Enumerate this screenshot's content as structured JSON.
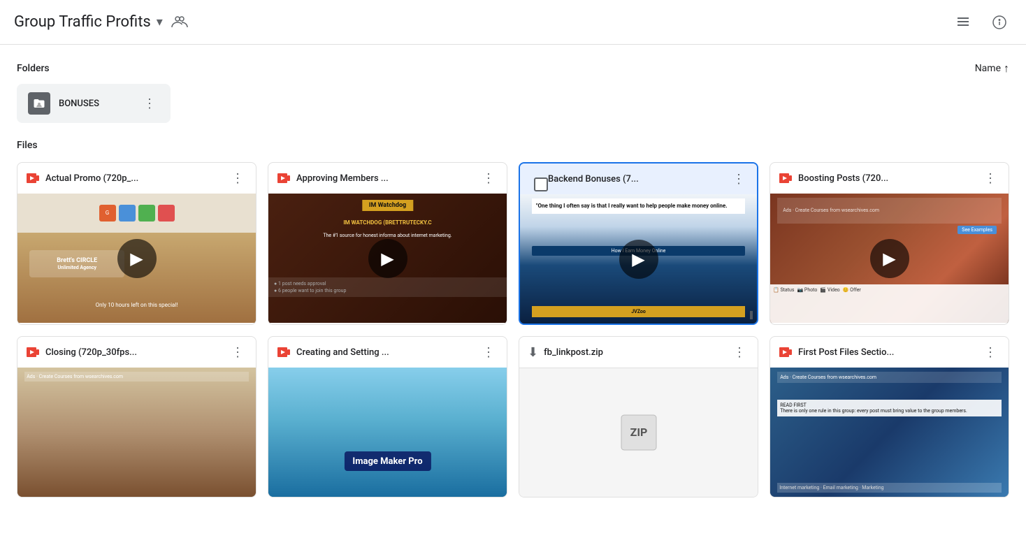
{
  "header": {
    "title": "Group Traffic Profits",
    "dropdown_label": "▾",
    "people_icon": "people-icon",
    "list_view_icon": "list-view-icon",
    "info_icon": "info-icon"
  },
  "sections": {
    "folders_label": "Folders",
    "files_label": "Files",
    "sort_label": "Name",
    "sort_direction": "↑"
  },
  "folders": [
    {
      "name": "BONUSES",
      "icon": "folder-person-icon"
    }
  ],
  "files": [
    {
      "name": "Actual Promo (720p_...",
      "type": "video",
      "thumb_class": "actual-thumb",
      "has_play": true,
      "selected": false
    },
    {
      "name": "Approving Members ...",
      "type": "video",
      "thumb_class": "approving-thumb",
      "has_play": true,
      "selected": false
    },
    {
      "name": "Backend Bonuses (7...",
      "type": "video",
      "thumb_class": "backend-thumb",
      "has_play": true,
      "selected": true,
      "has_checkbox": true
    },
    {
      "name": "Boosting Posts (720...",
      "type": "video",
      "thumb_class": "boosting-thumb",
      "has_play": true,
      "selected": false
    },
    {
      "name": "Closing (720p_30fps...",
      "type": "video",
      "thumb_class": "closing-thumb",
      "has_play": false,
      "selected": false
    },
    {
      "name": "Creating and Setting ...",
      "type": "video",
      "thumb_class": "creating-thumb",
      "has_play": false,
      "selected": false
    },
    {
      "name": "fb_linkpost.zip",
      "type": "zip",
      "thumb_class": "fb-thumb",
      "has_play": false,
      "selected": false
    },
    {
      "name": "First Post Files Sectio...",
      "type": "video",
      "thumb_class": "first-thumb",
      "has_play": false,
      "selected": false
    }
  ]
}
